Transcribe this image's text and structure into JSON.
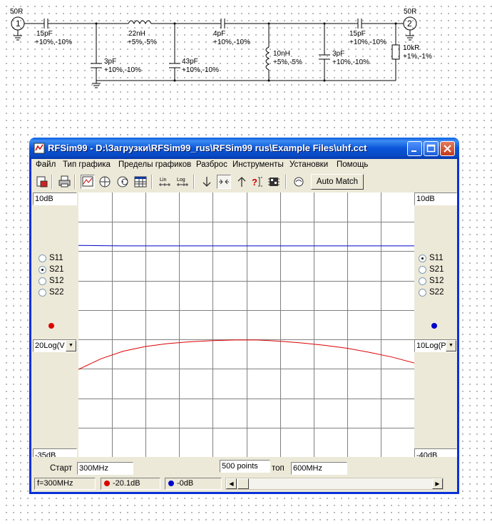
{
  "schematic": {
    "port1": {
      "impedance": "50R",
      "number": "1"
    },
    "port2": {
      "impedance": "50R",
      "number": "2"
    },
    "components": [
      {
        "id": "c1",
        "value": "15pF",
        "tolerance": "+10%,-10%"
      },
      {
        "id": "c2",
        "value": "3pF",
        "tolerance": "+10%,-10%"
      },
      {
        "id": "l1",
        "value": "22nH",
        "tolerance": "+5%,-5%"
      },
      {
        "id": "c3",
        "value": "43pF",
        "tolerance": "+10%,-10%"
      },
      {
        "id": "c4",
        "value": "4pF",
        "tolerance": "+10%,-10%"
      },
      {
        "id": "l2",
        "value": "10nH",
        "tolerance": "+5%,-5%"
      },
      {
        "id": "c5",
        "value": "3pF",
        "tolerance": "+10%,-10%"
      },
      {
        "id": "c6",
        "value": "15pF",
        "tolerance": "+10%,-10%"
      },
      {
        "id": "r1",
        "value": "10kR",
        "tolerance": "+1%,-1%"
      }
    ]
  },
  "window": {
    "title": "RFSim99 - D:\\Загрузки\\RFSim99_rus\\RFSim99 rus\\Example Files\\uhf.cct",
    "menu": [
      "Файл",
      "Тип графика",
      "Пределы графиков",
      "Разброс",
      "Инструменты",
      "Установки",
      "Помощь"
    ],
    "toolbar": {
      "auto_match_label": "Auto Match",
      "tools": [
        "save-print-icon",
        "printer-icon",
        "rect-plot-icon",
        "polar-plot-icon",
        "smith-chart-icon",
        "table-icon",
        "linear-scale-icon",
        "log-scale-icon",
        "arrow-down-icon",
        "zoom-in-icon",
        "arrow-up-icon",
        "help-icon",
        "chip-icon",
        "match-icon"
      ],
      "lin_label": "Lin",
      "log_label": "Log"
    }
  },
  "left_panel": {
    "top_value": "10dB",
    "bottom_value": "-35dB",
    "params": [
      "S11",
      "S21",
      "S12",
      "S22"
    ],
    "selected": "S21",
    "trace_color": "#dd0000",
    "format": "20Log(V"
  },
  "right_panel": {
    "top_value": "10dB",
    "bottom_value": "-40dB",
    "params": [
      "S11",
      "S21",
      "S12",
      "S22"
    ],
    "selected": "S11",
    "trace_color": "#0000cc",
    "format": "10Log(P"
  },
  "sweep": {
    "start_label": "Старт",
    "start_value": "300MHz",
    "points_value": "500 points",
    "stop_label": "топ",
    "stop_value": "600MHz"
  },
  "status_bar": {
    "frequency": "f=300MHz",
    "red_readout": "-20.1dB",
    "blue_readout": "-0dB"
  },
  "chart_data": {
    "type": "line",
    "title": "",
    "xlabel": "",
    "ylabel": "",
    "xlim": [
      300,
      600
    ],
    "grid": true,
    "series": [
      {
        "name": "S21",
        "axis": "left",
        "ylim": [
          -35,
          10
        ],
        "color": "#dd0000",
        "x": [
          300,
          320,
          340,
          360,
          380,
          400,
          420,
          440,
          460,
          480,
          500,
          520,
          540,
          560,
          580,
          600
        ],
        "y": [
          -20.1,
          -18.3,
          -17.0,
          -16.2,
          -15.7,
          -15.4,
          -15.2,
          -15.1,
          -15.1,
          -15.3,
          -15.6,
          -16.0,
          -16.5,
          -17.2,
          -18.0,
          -19.0
        ]
      },
      {
        "name": "S11",
        "axis": "right",
        "ylim": [
          -40,
          10
        ],
        "color": "#0000cc",
        "x": [
          300,
          320,
          340,
          360,
          600
        ],
        "y": [
          -0.0,
          -0.05,
          -0.1,
          -0.1,
          -0.1
        ]
      }
    ]
  }
}
